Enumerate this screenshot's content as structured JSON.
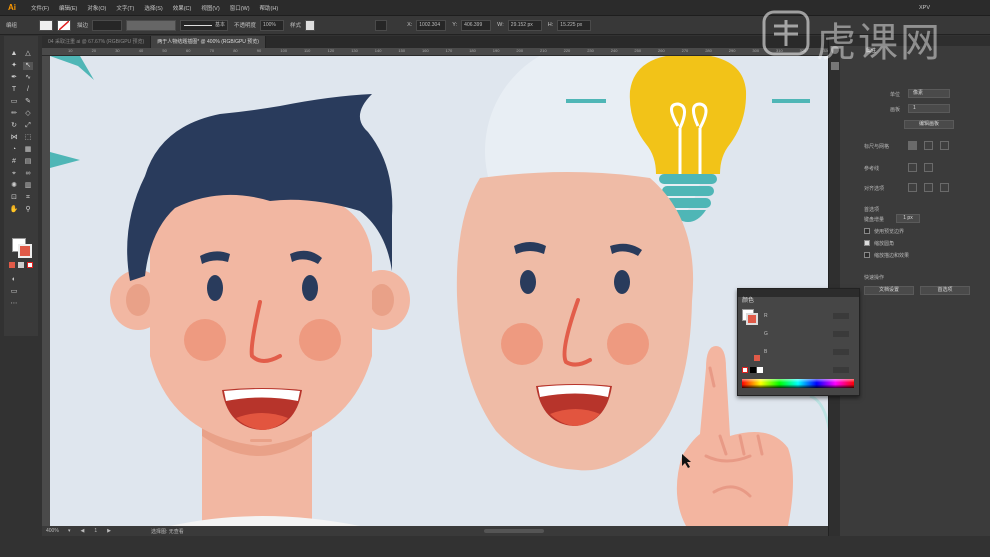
{
  "app": {
    "logo": "Ai"
  },
  "menu": {
    "items": [
      "文件(F)",
      "编辑(E)",
      "对象(O)",
      "文字(T)",
      "选择(S)",
      "效果(C)",
      "视图(V)",
      "窗口(W)",
      "帮助(H)"
    ],
    "right": "XPV"
  },
  "control": {
    "left_label": "编组",
    "stroke_label": "描边",
    "stroke_style": "基本",
    "opacity_label": "不透明度",
    "opacity_value": "100%",
    "style_label": "样式",
    "x_value": "1002.304",
    "y_value": "406.399",
    "w_value": "29.152 px",
    "h_value": "15.225 px"
  },
  "tabs": [
    "04 采取注重 ai @ 67.67% (RGB/GPU 预览)",
    "两于人物结题插图* @ 400% (RGB/GPU 预览)"
  ],
  "ruler": {
    "ticks": [
      "10",
      "20",
      "30",
      "40",
      "50",
      "60",
      "70",
      "80",
      "90",
      "100",
      "110",
      "120",
      "130",
      "140",
      "150",
      "160",
      "170",
      "180",
      "190",
      "200",
      "210",
      "220",
      "230",
      "240",
      "250",
      "260",
      "270",
      "280",
      "290",
      "300",
      "310",
      "320",
      "330"
    ]
  },
  "status": {
    "zoom": "400%",
    "page": "1",
    "tool": "选择图: 无查看"
  },
  "props": {
    "title": "属性",
    "unit_label": "单位",
    "unit_value": "像素",
    "artboard_label": "画板",
    "artboard_value": "1",
    "edit_button": "编辑画板",
    "ruler_grid": "标尺与网格",
    "guides": "参考线",
    "snap": "对齐选项",
    "prefs": "首选项",
    "keyboard_increment_label": "键盘增量",
    "keyboard_increment_value": "1 px",
    "check1": "使用预览边界",
    "check2": "缩放圆角",
    "check3": "缩放描边和效果",
    "quick_actions": "快速操作",
    "doc_settings_button": "文档设置",
    "prefs_button": "首选项"
  },
  "colorpanel": {
    "title": "颜色",
    "ch1": "R",
    "ch2": "G",
    "ch3": "B"
  },
  "watermark": "虎课网"
}
